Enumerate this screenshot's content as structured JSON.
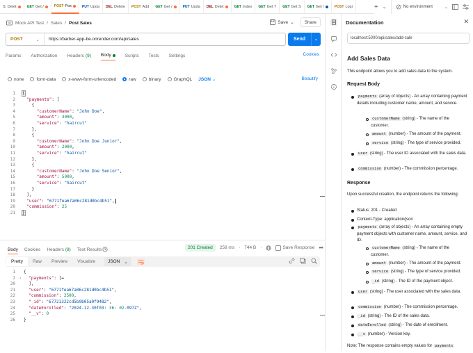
{
  "tabs": [
    {
      "method": "",
      "label": "S. Delet",
      "dot": "o"
    },
    {
      "method": "GET",
      "label": "Get /",
      "dot": "o"
    },
    {
      "method": "POST",
      "label": "Pos",
      "dot": "o",
      "active": true
    },
    {
      "method": "PUT",
      "label": "Upda",
      "dot": ""
    },
    {
      "method": "DEL",
      "label": "Delete",
      "dot": ""
    },
    {
      "method": "POST",
      "label": "Add",
      "dot": ""
    },
    {
      "method": "GET",
      "label": "Get /",
      "dot": "o"
    },
    {
      "method": "PUT",
      "label": "Upda",
      "dot": ""
    },
    {
      "method": "DEL",
      "label": "Delet",
      "dot": "o"
    },
    {
      "method": "GET",
      "label": "Index",
      "dot": ""
    },
    {
      "method": "GET",
      "label": "Get T",
      "dot": ""
    },
    {
      "method": "GET",
      "label": "Get S",
      "dot": ""
    },
    {
      "method": "GET",
      "label": "Get /",
      "dot": "b"
    },
    {
      "method": "POST",
      "label": "Logi",
      "dot": ""
    }
  ],
  "env_label": "No environment",
  "breadcrumb": {
    "workspace": "Mock API Test",
    "sep": "/",
    "folder": "Sales",
    "request": "Post Sales"
  },
  "save_label": "Save",
  "share_label": "Share",
  "request": {
    "method": "POST",
    "url": "https://barber-app-be.onrender.com/api/sales"
  },
  "send_label": "Send",
  "req_tabs": [
    {
      "label": "Params"
    },
    {
      "label": "Authorization"
    },
    {
      "label": "Headers",
      "count": "(9)"
    },
    {
      "label": "Body",
      "active": true
    },
    {
      "label": "Scripts"
    },
    {
      "label": "Tests"
    },
    {
      "label": "Settings"
    }
  ],
  "cookies_label": "Cookies",
  "body_types": [
    "none",
    "form-data",
    "x-www-form-urlencoded",
    "raw",
    "binary",
    "GraphQL"
  ],
  "body_selected": "raw",
  "body_format": "JSON",
  "beautify_label": "Beautify",
  "request_body": [
    "{",
    "  \"payments\": [",
    "    {",
    "      \"customerName\": \"John Doe\",",
    "      \"amount\": 3000,",
    "      \"service\": \"haircut\"",
    "    },",
    "    {",
    "      \"customerName\": \"John Doe Junior\",",
    "      \"amount\": 2000,",
    "      \"service\": \"haircut\"",
    "    },",
    "    {",
    "      \"customerName\": \"John Doe Senior\",",
    "      \"amount\": 5000,",
    "      \"service\": \"haircut\"",
    "    }",
    "  ],",
    "  \"user\": \"6771fea67a06c281d0bc4b51\",",
    "  \"commission\": 25",
    "}"
  ],
  "resp_tabs": [
    {
      "label": "Body",
      "active": true
    },
    {
      "label": "Cookies"
    },
    {
      "label": "Headers",
      "count": "(8)"
    },
    {
      "label": "Test Results"
    }
  ],
  "response_status": {
    "code": "201 Created",
    "time": "258 ms",
    "size": "744 B",
    "save": "Save Response"
  },
  "view_modes": [
    "Pretty",
    "Raw",
    "Preview",
    "Visualize"
  ],
  "view_selected": "Pretty",
  "view_format": "JSON",
  "response_body": [
    {
      "n": "1",
      "text": "{"
    },
    {
      "n": "2",
      "text": "  \"payments\": [↔",
      "fold": true
    },
    {
      "n": "20",
      "text": "  ],"
    },
    {
      "n": "21",
      "text": "  \"user\": \"6771fea67a06c281d0bc4b51\","
    },
    {
      "n": "22",
      "text": "  \"commission\": 2500,"
    },
    {
      "n": "23",
      "text": "  \"_id\": \"67721322cd5b9b05a0f9482\","
    },
    {
      "n": "24",
      "text": "  \"dateEnrolled\": \"2024-12-30T03:36:02.097Z\","
    },
    {
      "n": "25",
      "text": "  \"__v\": 0"
    },
    {
      "n": "26",
      "text": "}"
    }
  ],
  "documentation": {
    "title": "Documentation",
    "url": "localhost:5000/api/sales/add-sale",
    "heading": "Add Sales Data",
    "intro": "This endpoint allows you to add sales data to the system.",
    "request_body_heading": "Request Body",
    "payments_desc": "(array of objects) - An array containing payment details including customer name, amount, and service.",
    "customerName_desc": "(string) - The name of the customer.",
    "amount_desc": "(number) - The amount of the payment.",
    "service_desc": "(string) - The type of service provided.",
    "user_desc": "(string) - The user ID associated with the sales data.",
    "commission_desc": "(number) - The commission percentage.",
    "response_heading": "Response",
    "response_intro": "Upon successful creation, the endpoint returns the following:",
    "status_item": "Status: 201 - Created",
    "content_type_item": "Content-Type: application/json",
    "r_payments_desc": "(array of objects) - An array containing empty payment objects with customer name, amount, service, and ID.",
    "r_customerName_desc": "(string) - The name of the customer.",
    "r_amount_desc": "(number) - The amount of the payment.",
    "r_service_desc": "(string) - The type of service provided.",
    "r_id_desc": "(string) - The ID of the payment object.",
    "r_user_desc": "(string) - The user associated with the sales data.",
    "r_commission_desc": "(number) - The commission percentage.",
    "r_sid_desc": "(string) - The ID of the sales data.",
    "r_date_desc": "(string) - The date of enrollment.",
    "r_v_desc": "(number) - Version key.",
    "note": "Note: The response contains empty values for",
    "codes": {
      "payments": "payments",
      "customerName": "customerName",
      "amount": "amount",
      "service": "service",
      "user": "user",
      "commission": "commission",
      "_id": "_id",
      "dateEnrolled": "dateEnrolled",
      "__v": "__v"
    }
  }
}
